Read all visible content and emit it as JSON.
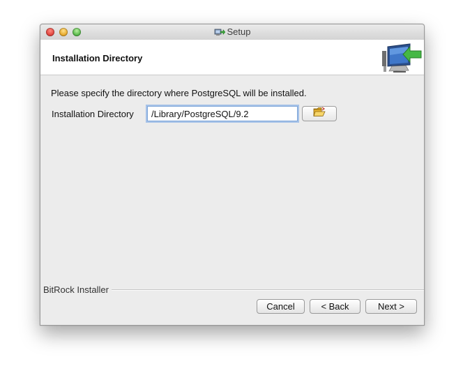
{
  "window": {
    "title": "Setup",
    "title_icon": "setup-app-icon"
  },
  "header": {
    "title": "Installation Directory",
    "graphic_icon": "computer-install-arrow-icon"
  },
  "body": {
    "instructions": "Please specify the directory where PostgreSQL will be installed.",
    "directory_label": "Installation Directory",
    "directory_value": "/Library/PostgreSQL/9.2",
    "browse_icon": "folder-icon"
  },
  "footer": {
    "brand": "BitRock Installer",
    "cancel_label": "Cancel",
    "back_label": "< Back",
    "next_label": "Next >"
  },
  "colors": {
    "window_bg": "#ececec",
    "header_bg": "#ffffff",
    "focus_ring": "#7ea6d8"
  }
}
